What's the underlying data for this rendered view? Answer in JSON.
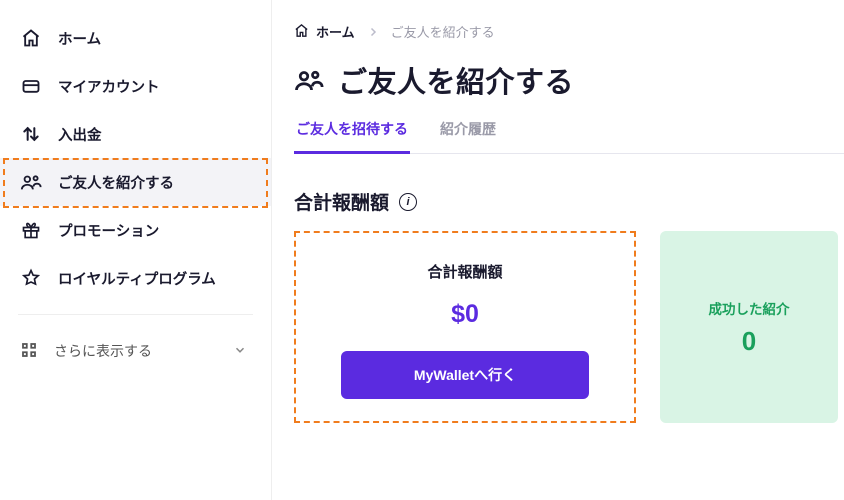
{
  "sidebar": {
    "items": [
      {
        "label": "ホーム"
      },
      {
        "label": "マイアカウント"
      },
      {
        "label": "入出金"
      },
      {
        "label": "ご友人を紹介する"
      },
      {
        "label": "プロモーション"
      },
      {
        "label": "ロイヤルティプログラム"
      }
    ],
    "show_more_label": "さらに表示する"
  },
  "breadcrumb": {
    "home": "ホーム",
    "current": "ご友人を紹介する"
  },
  "page_title": "ご友人を紹介する",
  "tabs": {
    "invite": "ご友人を招待する",
    "history": "紹介履歴"
  },
  "section": {
    "title": "合計報酬額",
    "info_icon": "i"
  },
  "reward_card": {
    "title": "合計報酬額",
    "amount": "$0",
    "button": "MyWalletへ行く"
  },
  "success_card": {
    "label": "成功した紹介",
    "count": "0"
  }
}
